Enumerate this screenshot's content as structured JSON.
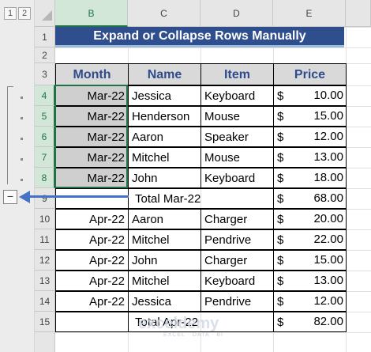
{
  "outline": {
    "level_buttons": [
      "1",
      "2"
    ],
    "collapse_symbol": "−"
  },
  "columns": [
    "B",
    "C",
    "D",
    "E"
  ],
  "rows": [
    "1",
    "2",
    "3",
    "4",
    "5",
    "6",
    "7",
    "8",
    "9",
    "10",
    "11",
    "12",
    "13",
    "14",
    "15"
  ],
  "title": "Expand or Collapse Rows Manually",
  "headers": {
    "month": "Month",
    "name": "Name",
    "item": "Item",
    "price": "Price"
  },
  "records": [
    {
      "month": "Mar-22",
      "name": "Jessica",
      "item": "Keyboard",
      "currency": "$",
      "price": "10.00"
    },
    {
      "month": "Mar-22",
      "name": "Henderson",
      "item": "Mouse",
      "currency": "$",
      "price": "15.00"
    },
    {
      "month": "Mar-22",
      "name": "Aaron",
      "item": "Speaker",
      "currency": "$",
      "price": "12.00"
    },
    {
      "month": "Mar-22",
      "name": "Mitchel",
      "item": "Mouse",
      "currency": "$",
      "price": "13.00"
    },
    {
      "month": "Mar-22",
      "name": "John",
      "item": "Keyboard",
      "currency": "$",
      "price": "18.00"
    },
    {
      "month": "Apr-22",
      "name": "Aaron",
      "item": "Charger",
      "currency": "$",
      "price": "20.00"
    },
    {
      "month": "Apr-22",
      "name": "Mitchel",
      "item": "Pendrive",
      "currency": "$",
      "price": "22.00"
    },
    {
      "month": "Apr-22",
      "name": "John",
      "item": "Charger",
      "currency": "$",
      "price": "15.00"
    },
    {
      "month": "Apr-22",
      "name": "Mitchel",
      "item": "Keyboard",
      "currency": "$",
      "price": "13.00"
    },
    {
      "month": "Apr-22",
      "name": "Jessica",
      "item": "Pendrive",
      "currency": "$",
      "price": "12.00"
    }
  ],
  "totals": [
    {
      "label": "Total Mar-22",
      "currency": "$",
      "price": "68.00"
    },
    {
      "label": "Total Apr-22",
      "currency": "$",
      "price": "82.00"
    }
  ],
  "watermark": {
    "brand": "exceldemy",
    "tagline": "EXCEL · DATA · BI"
  },
  "colors": {
    "title_bg": "#2f4e8e",
    "header_text": "#2e4b8c",
    "selection": "#217346",
    "arrow": "#4472c4"
  }
}
